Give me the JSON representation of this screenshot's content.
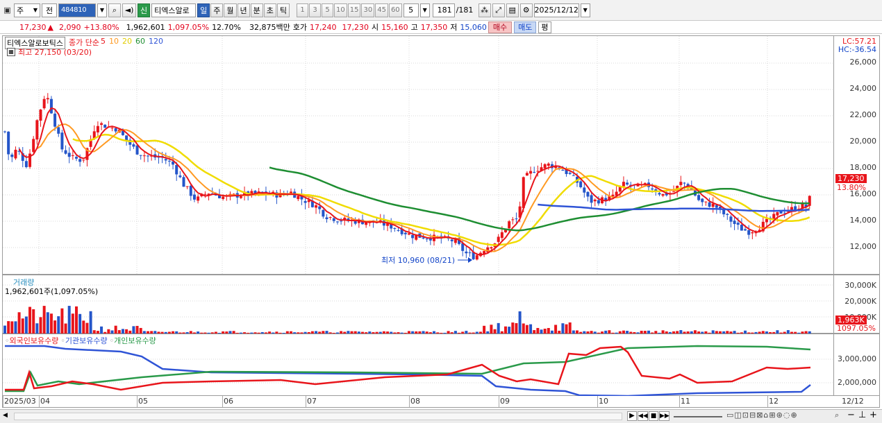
{
  "toolbar": {
    "period": "주",
    "market": "전",
    "code": "484810",
    "shin": "신",
    "name": "티엑스알로",
    "intervals": [
      "일",
      "주",
      "월",
      "년",
      "분",
      "초",
      "틱"
    ],
    "selected_interval": "일",
    "counts": [
      "1",
      "3",
      "5",
      "10",
      "15",
      "30",
      "45",
      "60"
    ],
    "count_value": "5",
    "page_current": "181",
    "page_total": "/181",
    "date": "2025/12/12"
  },
  "quote": {
    "price": "17,230",
    "arrow": "▲",
    "change": "2,090",
    "change_pct": "+13.80%",
    "volume": "1,962,601",
    "volume_pct": "1,097.05%",
    "turnover": "12.70%",
    "amount": "32,875백만",
    "hoga_label": "호가",
    "ask": "17,240",
    "bid": "17,230",
    "open_label": "시",
    "open": "15,160",
    "high_label": "고",
    "high": "17,350",
    "low_label": "저",
    "low": "15,060",
    "buy_label": "매수",
    "sell_label": "매도",
    "avg_label": "평"
  },
  "main_panel": {
    "name": "티엑스알로보틱스",
    "legend_label": "종가 단순",
    "ma": [
      {
        "label": "5",
        "color": "#e8151b"
      },
      {
        "label": "10",
        "color": "#ff9a22"
      },
      {
        "label": "20",
        "color": "#f0dc00"
      },
      {
        "label": "60",
        "color": "#1e8e32"
      },
      {
        "label": "120",
        "color": "#2f54d6"
      }
    ],
    "high_note": "최고 27,150 (03/20)",
    "low_note": "최저 10,960 (08/21)",
    "lc": "LC:57.21",
    "hc": "HC:-36.54",
    "y_labels": [
      "26,000",
      "24,000",
      "22,000",
      "20,000",
      "18,000",
      "16,000",
      "14,000",
      "12,000"
    ],
    "last_price_tag": "17,230",
    "last_pct_tag": "13.80%"
  },
  "volume_panel": {
    "title": "거래량",
    "value": "1,962,601주(1,097.05%)",
    "y_labels": [
      "30,000K",
      "20,000K",
      "10,000K"
    ],
    "tag_value": "1,963K",
    "tag_pct": "1097.05%"
  },
  "holdings_panel": {
    "legend": [
      {
        "label": "외국인보유수량",
        "color": "#e8151b"
      },
      {
        "label": "기관보유수량",
        "color": "#2f54d6"
      },
      {
        "label": "개인보유수량",
        "color": "#2a9a4a"
      }
    ],
    "y_labels": [
      "3,000,000",
      "2,000,000"
    ]
  },
  "x_axis": {
    "labels": [
      "2025/03",
      "04",
      "05",
      "06",
      "07",
      "08",
      "09",
      "10",
      "11",
      "12"
    ],
    "right_label": "12/12"
  },
  "colors": {
    "up": "#e8151b",
    "down": "#2455c9",
    "accent": "#2e63b8"
  },
  "icons": [
    "window-icon",
    "dropdown-icon",
    "search-icon",
    "sound-icon",
    "chart-tools-icon",
    "save-icon",
    "settings-icon",
    "play-icon",
    "pause-icon",
    "zoom-icon"
  ]
}
